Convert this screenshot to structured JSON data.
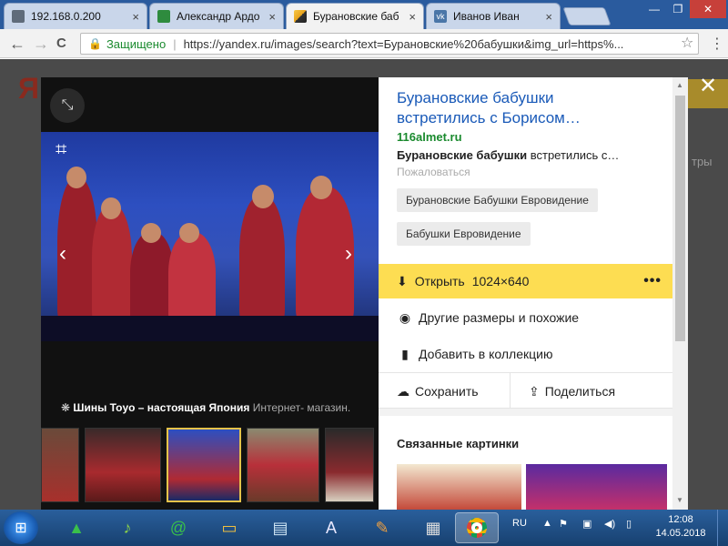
{
  "browser": {
    "tabs": [
      {
        "title": "192.168.0.200",
        "favicon_color": "#5f6b7a",
        "active": false
      },
      {
        "title": "Александр Ардо",
        "favicon_color": "#2e8b3e",
        "active": false
      },
      {
        "title": "Бурановские баб",
        "favicon_color": "#e8a21b",
        "active": true
      },
      {
        "title": "Иванов Иван",
        "favicon_color": "#4a76a8",
        "active": false
      }
    ],
    "tab_close": "×",
    "window_controls": {
      "minimize": "—",
      "maximize": "❐",
      "close": "✕"
    },
    "back": "←",
    "forward": "→",
    "reload": "C",
    "secure_label": "Защищено",
    "url": "https://yandex.ru/images/search?text=Бурановские%20бабушки&img_url=https%...",
    "star": "☆",
    "menu": "⋮"
  },
  "background": {
    "logo": "Ян",
    "right_text": "тры"
  },
  "viewer": {
    "expand_icon": "⤡",
    "crop_icon": "⌗",
    "prev": "‹",
    "next": "›",
    "ad": {
      "icon": "❋",
      "bold": "Шины Toyo – настоящая Япония",
      "rest": "Интернет- магазин."
    }
  },
  "sidebar": {
    "title": "Бурановские бабушки встретились с Борисом…",
    "domain": "116almet.ru",
    "snippet_bold": "Бурановские бабушки",
    "snippet_rest": " встретились с…",
    "complain": "Пожаловаться",
    "tags": [
      "Бурановские Бабушки Евровидение",
      "Бабушки Евровидение"
    ],
    "open_label": "Открыть",
    "open_size": "1024×640",
    "more": "•••",
    "other_sizes": "Другие размеры и похожие",
    "add_collection": "Добавить в коллекцию",
    "save": "Сохранить",
    "share": "Поделиться",
    "related_heading": "Связанные картинки"
  },
  "close": "✕",
  "taskbar": {
    "lang": "RU",
    "time": "12:08",
    "date": "14.05.2018"
  }
}
